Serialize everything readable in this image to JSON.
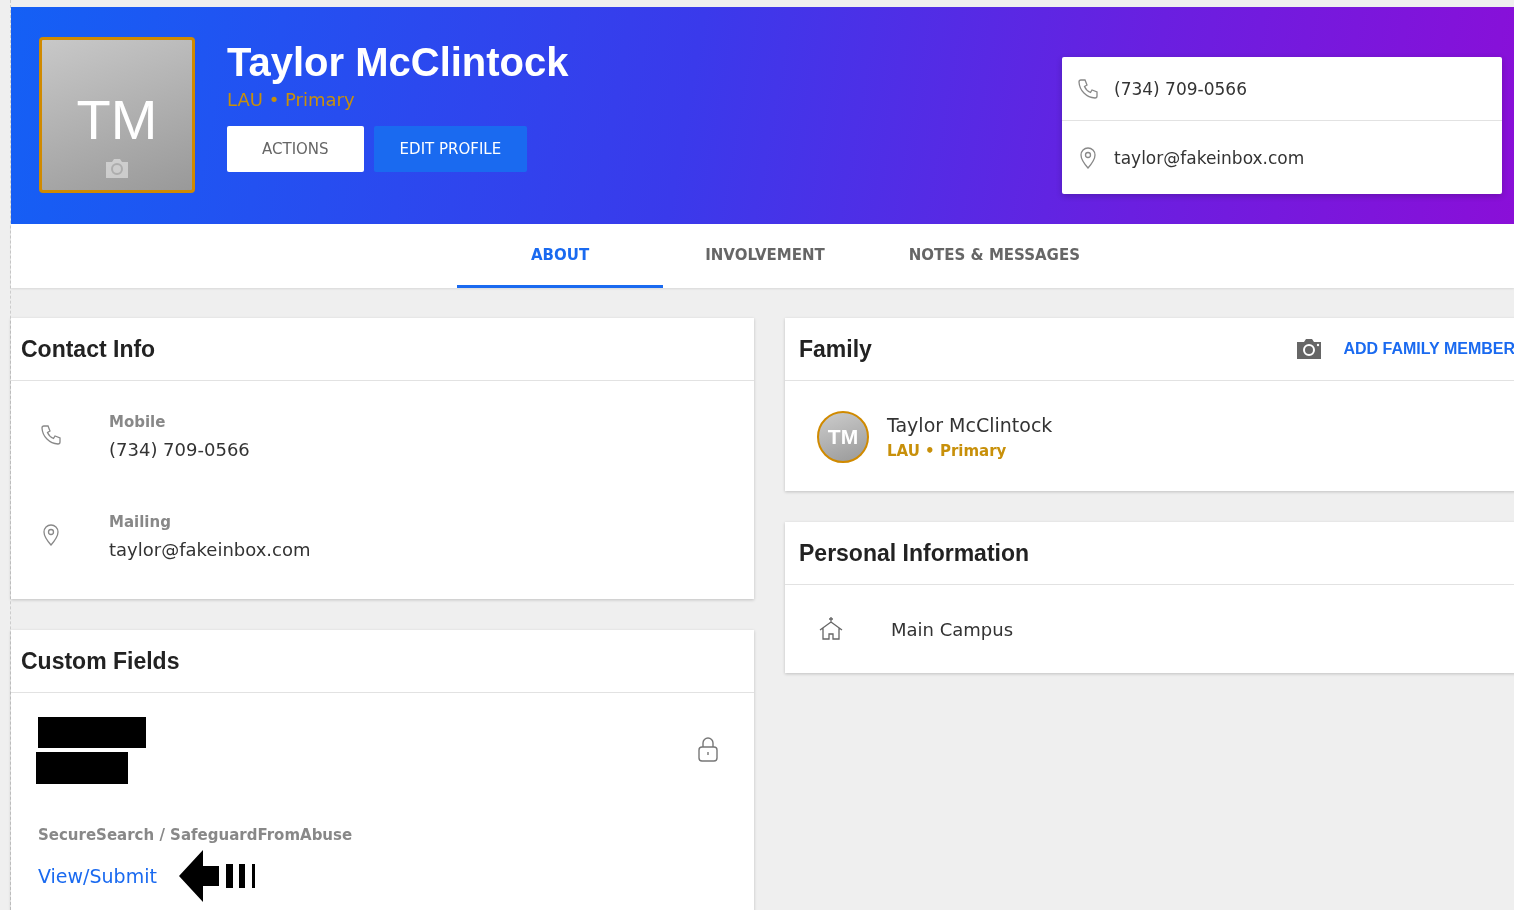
{
  "profile": {
    "initials": "TM",
    "name": "Taylor McClintock",
    "subtitle": "LAU • Primary",
    "buttons": [
      {
        "label": "ACTIONS",
        "kind": "secondary"
      },
      {
        "label": "EDIT PROFILE",
        "kind": "primary"
      }
    ],
    "contact_box": [
      {
        "kind": "phone",
        "text": "(734) 709-0566"
      },
      {
        "kind": "location",
        "text": "taylor@fakeinbox.com"
      }
    ]
  },
  "tabs": [
    {
      "label": "ABOUT",
      "selected": true
    },
    {
      "label": "INVOLVEMENT",
      "selected": false
    },
    {
      "label": "NOTES & MESSAGES",
      "selected": false
    }
  ],
  "contact_info": {
    "title": "Contact Info",
    "items": [
      {
        "kind": "phone",
        "label": "Mobile",
        "value": "(734) 709-0566"
      },
      {
        "kind": "location",
        "label": "Mailing",
        "value": "taylor@fakeinbox.com"
      }
    ]
  },
  "custom_fields": {
    "title": "Custom Fields",
    "field_label": "SecureSearch / SafeguardFromAbuse",
    "link": "View/Submit"
  },
  "family": {
    "title": "Family",
    "action": "ADD FAMILY MEMBER",
    "members": [
      {
        "initials": "TM",
        "name": "Taylor McClintock",
        "subtitle": "LAU • Primary"
      }
    ]
  },
  "personal_information": {
    "title": "Personal Information",
    "items": [
      {
        "kind": "campus",
        "value": "Main Campus"
      }
    ]
  }
}
